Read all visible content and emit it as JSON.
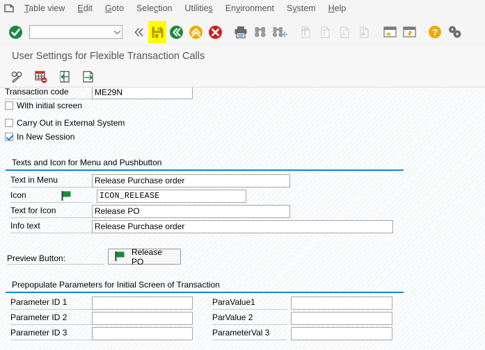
{
  "window": {
    "title": "User Settings for Flexible Transaction Calls"
  },
  "menubar": {
    "system_icon": "sap-system-menu-icon",
    "items": [
      {
        "label": "Table view",
        "accel": "T"
      },
      {
        "label": "Edit",
        "accel": "E"
      },
      {
        "label": "Goto",
        "accel": "G"
      },
      {
        "label": "Selection",
        "accel": "c"
      },
      {
        "label": "Utilities",
        "accel": "s"
      },
      {
        "label": "Environment",
        "accel": "v"
      },
      {
        "label": "System",
        "accel": "y"
      },
      {
        "label": "Help",
        "accel": "H"
      }
    ]
  },
  "toolbar": {
    "command_field_value": "",
    "command_field_placeholder": "",
    "buttons": [
      {
        "name": "enter-button",
        "icon": "green-check-icon",
        "enabled": true
      },
      {
        "name": "command-history-button",
        "icon": "chevron-down-icon",
        "enabled": true
      },
      {
        "name": "collapse-toolbar-button",
        "icon": "double-chevron-left-icon",
        "enabled": true
      },
      {
        "name": "save-button",
        "icon": "floppy-save-icon",
        "enabled": true,
        "highlighted": true
      },
      {
        "name": "back-button",
        "icon": "green-back-arrow-icon",
        "enabled": true
      },
      {
        "name": "exit-button",
        "icon": "yellow-up-arrow-icon",
        "enabled": true
      },
      {
        "name": "cancel-button",
        "icon": "red-cross-icon",
        "enabled": true
      },
      {
        "name": "print-button",
        "icon": "printer-icon",
        "enabled": true
      },
      {
        "name": "find-button",
        "icon": "binoculars-icon",
        "enabled": true
      },
      {
        "name": "find-next-button",
        "icon": "binoculars-plus-icon",
        "enabled": true
      },
      {
        "name": "first-page-button",
        "icon": "page-up-first-icon",
        "enabled": false
      },
      {
        "name": "previous-page-button",
        "icon": "page-up-icon",
        "enabled": false
      },
      {
        "name": "next-page-button",
        "icon": "page-down-icon",
        "enabled": false
      },
      {
        "name": "last-page-button",
        "icon": "page-down-last-icon",
        "enabled": false
      },
      {
        "name": "create-shortcut-button",
        "icon": "window-star-icon",
        "enabled": true
      },
      {
        "name": "create-session-button",
        "icon": "window-arrow-icon",
        "enabled": true
      },
      {
        "name": "help-button",
        "icon": "orange-question-icon",
        "enabled": true
      },
      {
        "name": "customize-layout-button",
        "icon": "gears-icon",
        "enabled": true
      }
    ]
  },
  "app_toolbar": {
    "buttons": [
      {
        "name": "display-change-button",
        "icon": "glasses-pencil-icon"
      },
      {
        "name": "delete-row-button",
        "icon": "table-delete-row-icon"
      },
      {
        "name": "import-button",
        "icon": "import-arrow-left-icon"
      },
      {
        "name": "export-button",
        "icon": "export-arrow-right-icon"
      }
    ]
  },
  "form": {
    "transaction_code": {
      "label": "Transaction code",
      "value": "ME29N"
    },
    "checkboxes": [
      {
        "label": "With initial screen",
        "checked": false
      },
      {
        "label": "Carry Out in External System",
        "checked": false
      },
      {
        "label": "In New Session",
        "checked": true
      }
    ]
  },
  "texts_group": {
    "title": "Texts and Icon for Menu and Pushbutton",
    "rows": [
      {
        "label": "Text in Menu",
        "value": "Release Purchase order"
      },
      {
        "label": "Icon",
        "value": "ICON_RELEASE",
        "preview_icon": "green-flag-icon"
      },
      {
        "label": "Text for Icon",
        "value": "Release PO"
      },
      {
        "label": "Info text",
        "value": "Release Purchase order"
      }
    ]
  },
  "preview": {
    "label": "Preview Button:",
    "button_text": "Release PO",
    "button_icon": "green-flag-icon"
  },
  "params_group": {
    "title": "Prepopulate Parameters for Initial Screen of Transaction",
    "rows": [
      {
        "id_label": "Parameter ID 1",
        "id_value": "",
        "val_label": "ParaValue1",
        "val_value": ""
      },
      {
        "id_label": "Parameter ID 2",
        "id_value": "",
        "val_label": "ParValue 2",
        "val_value": ""
      },
      {
        "id_label": "Parameter ID 3",
        "id_value": "",
        "val_label": "ParameterVal 3",
        "val_value": ""
      }
    ]
  },
  "colors": {
    "accent_blue": "#0a8bd0",
    "highlight_yellow": "#ffff00",
    "green": "#1a8a3c",
    "red": "#cc1f22",
    "orange": "#f0ab00"
  }
}
